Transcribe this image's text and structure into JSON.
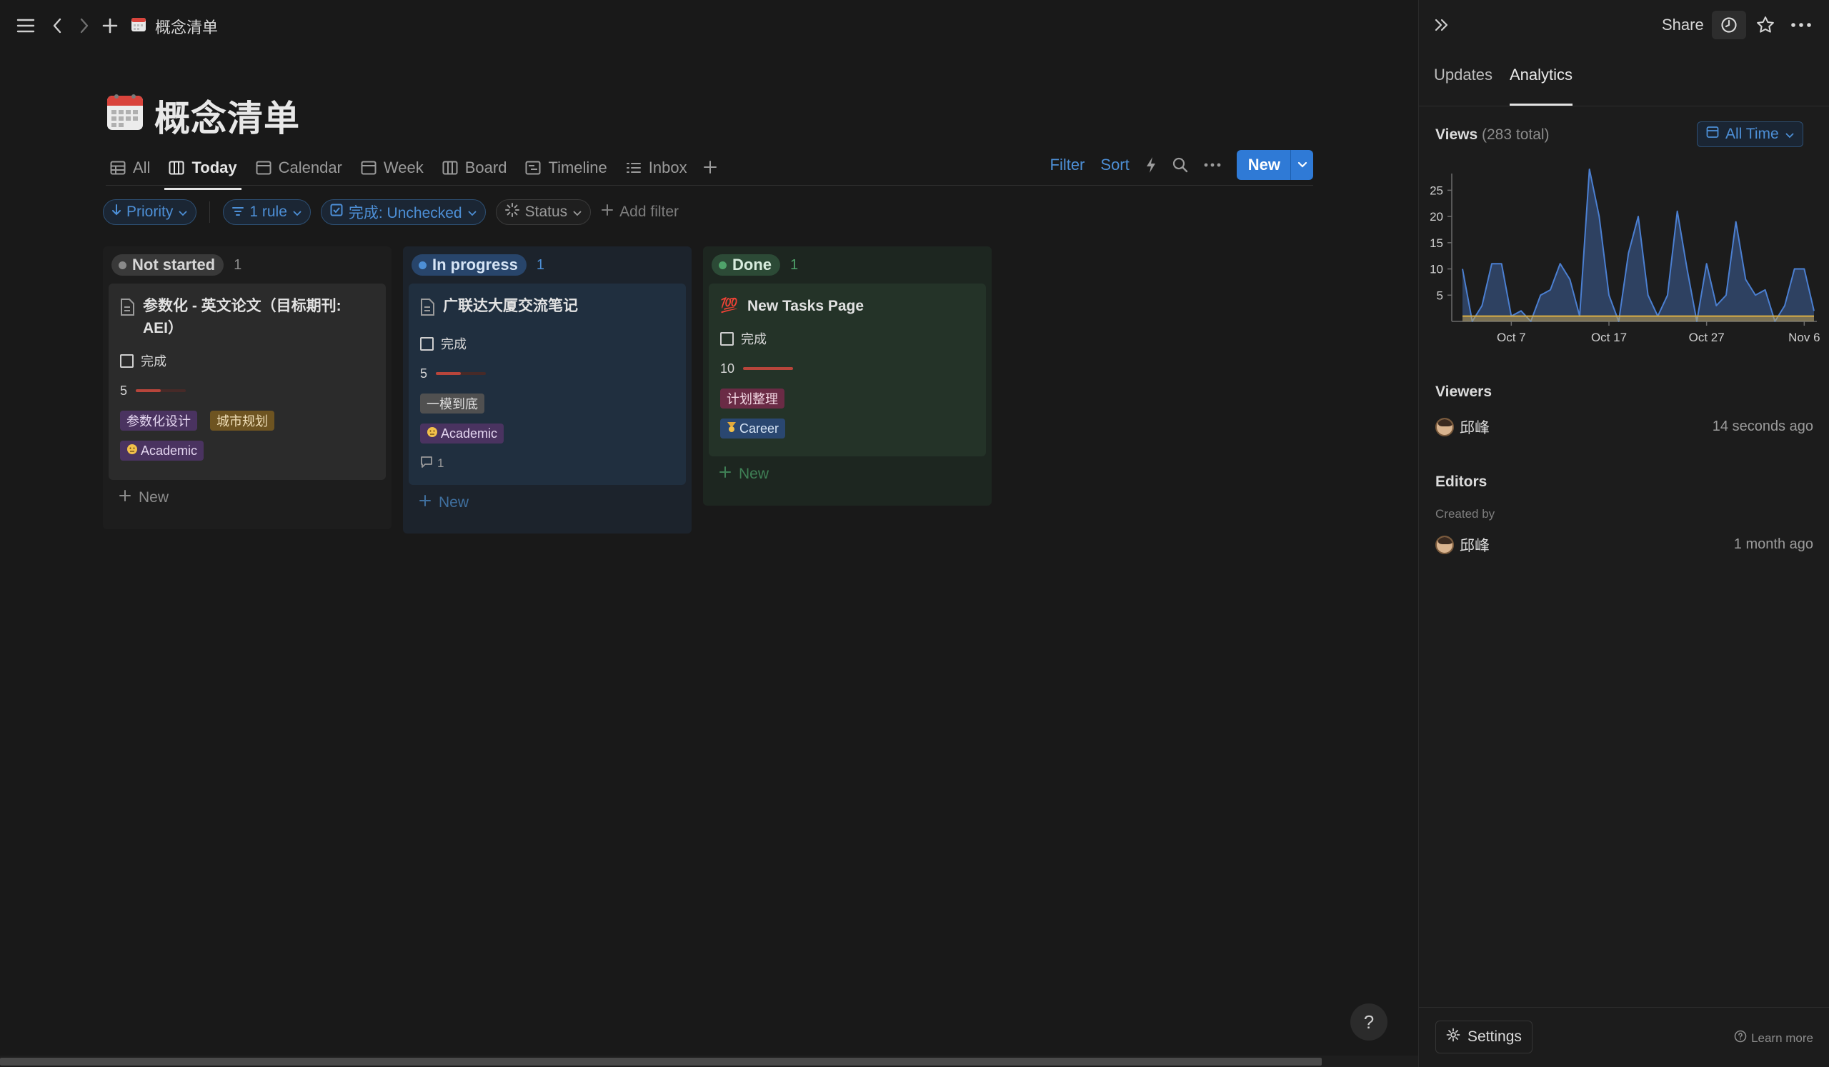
{
  "topbar": {
    "title": "概念清单"
  },
  "page": {
    "title": "概念清单"
  },
  "views": {
    "tabs": [
      {
        "label": "All",
        "icon": "table-icon"
      },
      {
        "label": "Today",
        "icon": "board-icon",
        "active": true
      },
      {
        "label": "Calendar",
        "icon": "calendar-icon"
      },
      {
        "label": "Week",
        "icon": "calendar-week-icon"
      },
      {
        "label": "Board",
        "icon": "board-icon"
      },
      {
        "label": "Timeline",
        "icon": "timeline-icon"
      },
      {
        "label": "Inbox",
        "icon": "list-icon"
      }
    ],
    "actions": {
      "filter": "Filter",
      "sort": "Sort",
      "new": "New"
    }
  },
  "filters": {
    "priority": "Priority",
    "rule": "1 rule",
    "done": "完成: Unchecked",
    "status": "Status",
    "add": "Add filter"
  },
  "board": {
    "columns": [
      {
        "status": "Not started",
        "count": "1",
        "new_label": "New",
        "card": {
          "title": "参数化 - 英文论文（目标期刊: AEI）",
          "title_line1": "参数化 - 英文论文（目标期刊:",
          "title_line2": "AEI）",
          "checkbox_label": "完成",
          "checked": false,
          "priority": "5",
          "priority_fraction": 0.5,
          "tags": [
            "参数化设计",
            "城市规划"
          ],
          "category": "Academic"
        }
      },
      {
        "status": "In progress",
        "count": "1",
        "new_label": "New",
        "card": {
          "title": "广联达大厦交流笔记",
          "checkbox_label": "完成",
          "checked": false,
          "priority": "5",
          "priority_fraction": 0.5,
          "tags": [
            "一模到底"
          ],
          "category": "Academic",
          "comments": "1"
        }
      },
      {
        "status": "Done",
        "count": "1",
        "new_label": "New",
        "card": {
          "title": "New Tasks Page",
          "emoji": "💯",
          "checkbox_label": "完成",
          "checked": false,
          "priority": "10",
          "priority_fraction": 1.0,
          "tags": [
            "计划整理"
          ],
          "category": "Career"
        }
      }
    ]
  },
  "panel": {
    "share": "Share",
    "tabs": [
      {
        "label": "Updates"
      },
      {
        "label": "Analytics",
        "active": true
      }
    ],
    "views_title": "Views",
    "views_total": "(283 total)",
    "range": "All Time",
    "viewers_title": "Viewers",
    "viewer": {
      "name": "邱峰",
      "time": "14 seconds ago"
    },
    "editors_title": "Editors",
    "created_by": "Created by",
    "editor": {
      "name": "邱峰",
      "time": "1 month ago"
    },
    "settings": "Settings",
    "learn_more": "Learn more"
  },
  "chart_data": {
    "type": "area",
    "title": "",
    "xlabel": "",
    "ylabel": "",
    "x_ticks": [
      "Oct 7",
      "Oct 17",
      "Oct 27",
      "Nov 6"
    ],
    "y_ticks": [
      5,
      10,
      15,
      20,
      25
    ],
    "ylim": [
      0,
      29
    ],
    "series": [
      {
        "color": "#4b7fd1",
        "values": [
          10,
          0,
          3,
          11,
          11,
          1,
          2,
          0,
          5,
          6,
          11,
          8,
          1,
          29,
          20,
          5,
          0,
          13,
          20,
          5,
          1,
          5,
          21,
          10,
          0,
          11,
          3,
          5,
          19,
          8,
          5,
          6,
          0,
          3,
          10,
          10,
          2
        ]
      },
      {
        "color": "#d8ad46",
        "values": [
          1,
          1,
          1,
          1,
          1,
          1,
          1,
          1,
          1,
          1,
          1,
          1,
          1,
          1,
          1,
          1,
          1,
          1,
          1,
          1,
          1,
          1,
          1,
          1,
          1,
          1,
          1,
          1,
          1,
          1,
          1,
          1,
          1,
          1,
          1,
          1,
          1
        ]
      }
    ]
  }
}
